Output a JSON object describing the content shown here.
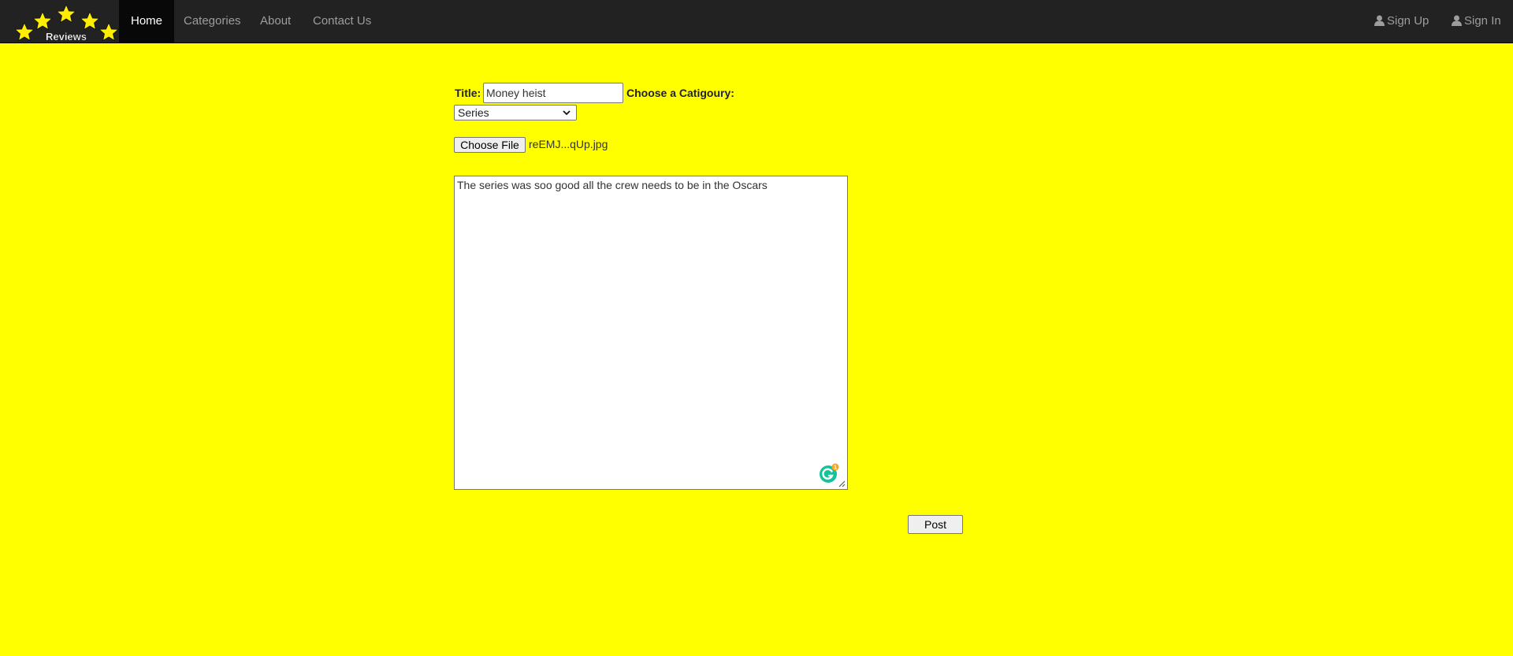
{
  "navbar": {
    "logo_text": "Reviews",
    "items": [
      {
        "label": "Home",
        "active": true
      },
      {
        "label": "Categories",
        "active": false
      },
      {
        "label": "About",
        "active": false
      },
      {
        "label": "Contact Us",
        "active": false
      }
    ],
    "signup": {
      "label": "Sign Up",
      "icon": "user-icon"
    },
    "signin": {
      "label": "Sign In",
      "icon": "user-icon"
    }
  },
  "form": {
    "title_label": "Title:",
    "title_value": "Money heist",
    "category_label": "Choose a Catigoury:",
    "category_selected": "Series",
    "file_button": "Choose File",
    "file_name": "reEMJ...qUp.jpg",
    "review_text": "The series was soo good all the crew needs to be in the Oscars",
    "grammarly_badge": "1",
    "post_button": "Post"
  },
  "colors": {
    "background": "#ffff00",
    "navbar": "#222222",
    "nav_active": "#080808",
    "star": "#ffee00",
    "grammarly": "#15c39a"
  }
}
